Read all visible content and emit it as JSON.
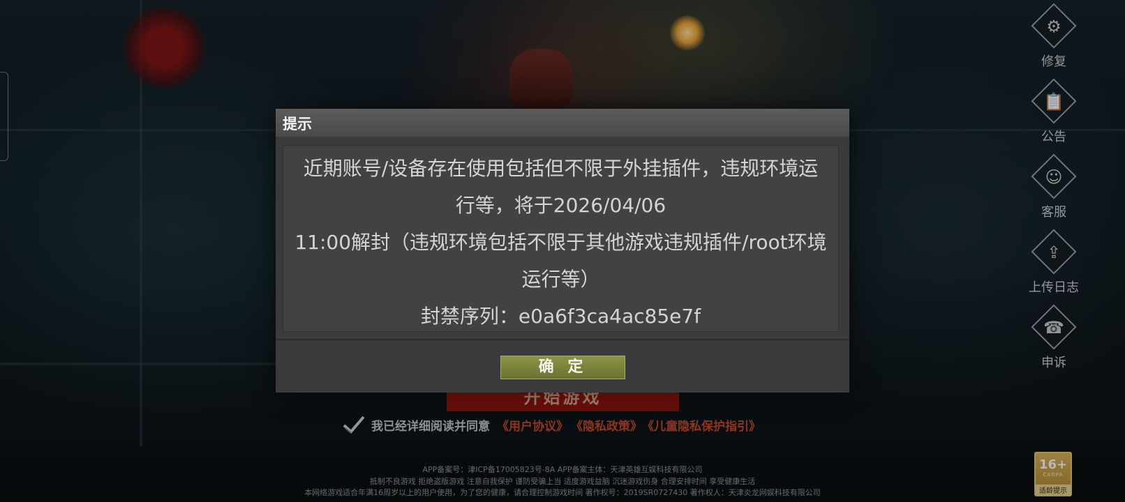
{
  "side_menu": {
    "items": [
      {
        "label": "修复",
        "icon": "gears-icon"
      },
      {
        "label": "公告",
        "icon": "notice-icon"
      },
      {
        "label": "客服",
        "icon": "headset-icon"
      },
      {
        "label": "上传日志",
        "icon": "upload-icon"
      },
      {
        "label": "申诉",
        "icon": "phone-icon"
      }
    ]
  },
  "dialog": {
    "title": "提示",
    "message_lines": [
      "近期账号/设备存在使用包括但不限于外挂插件，违规环境运",
      "行等，将于2026/04/06",
      "11:00解封（违规环境包括不限于其他游戏违规插件/root环境",
      "运行等）",
      "封禁序列：e0a6f3ca4ac85e7f"
    ],
    "confirm_label": "确 定"
  },
  "start_button_label": "开始游戏",
  "agreement": {
    "text": "我已经详细阅读并同意",
    "links": [
      "《用户协议》",
      "《隐私政策》",
      "《儿童隐私保护指引》"
    ]
  },
  "footer": {
    "line1": "APP备案号：津ICP备17005823号-8A    APP备案主体：天津英雄互娱科技有限公司",
    "line2": "抵制不良游戏  拒绝盗版游戏  注意自我保护  谨防受骗上当  适度游戏益脑  沉迷游戏伤身  合理安排时间  享受健康生活",
    "line3": "本网络游戏适合年满16周岁以上的用户使用，为了您的健康，请合理控制游戏时间    著作权号：2019SR0727430    著作权人：天津炎龙网娱科技有限公司"
  },
  "age_rating": {
    "value": "16+",
    "org": "CADPA",
    "tip": "适龄提示"
  },
  "colors": {
    "confirm_button": "#7d8440",
    "link_red": "#c9492a",
    "start_button": "#a8190f",
    "age_badge": "#c9a24a"
  }
}
